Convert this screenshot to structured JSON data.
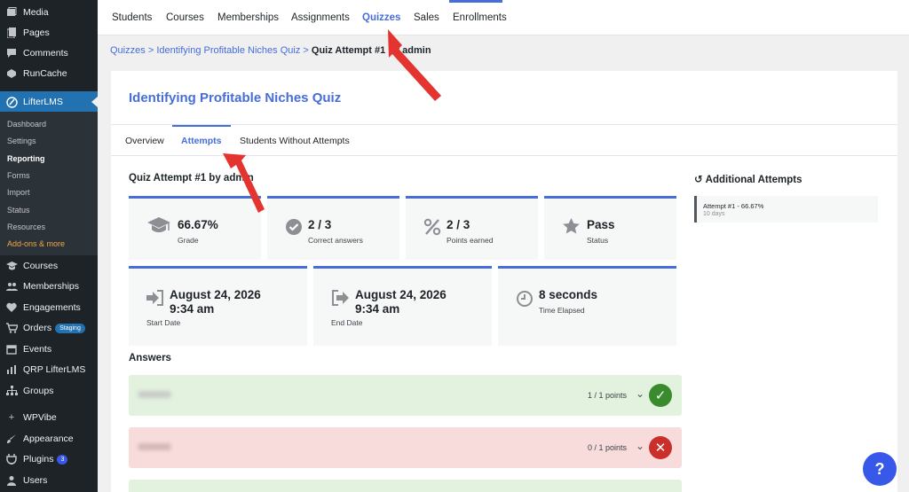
{
  "sidebar": {
    "items": [
      {
        "label": "Media",
        "icon": "media-icon"
      },
      {
        "label": "Pages",
        "icon": "pages-icon"
      },
      {
        "label": "Comments",
        "icon": "comments-icon"
      },
      {
        "label": "RunCache",
        "icon": "runcache-icon"
      },
      {
        "label": "LifterLMS",
        "icon": "lifterlms-icon"
      },
      {
        "label": "Courses",
        "icon": "courses-icon"
      },
      {
        "label": "Memberships",
        "icon": "memberships-icon"
      },
      {
        "label": "Engagements",
        "icon": "engagements-icon"
      },
      {
        "label": "Orders",
        "icon": "cart-icon",
        "badge": "Staging"
      },
      {
        "label": "Events",
        "icon": "events-icon"
      },
      {
        "label": "QRP LifterLMS",
        "icon": "chart-icon"
      },
      {
        "label": "Groups",
        "icon": "groups-icon"
      },
      {
        "label": "WPVibe",
        "icon": "plus-icon"
      },
      {
        "label": "Appearance",
        "icon": "appearance-icon"
      },
      {
        "label": "Plugins",
        "icon": "plugins-icon",
        "badge": "3"
      },
      {
        "label": "Users",
        "icon": "users-icon"
      }
    ],
    "submenu": [
      "Dashboard",
      "Settings",
      "Reporting",
      "Forms",
      "Import",
      "Status",
      "Resources",
      "Add-ons & more"
    ]
  },
  "topnav": [
    "Students",
    "Courses",
    "Memberships",
    "Assignments",
    "Quizzes",
    "Sales",
    "Enrollments"
  ],
  "breadcrumb": {
    "root": "Quizzes",
    "sep": ">",
    "quiz": "Identifying Profitable Niches Quiz",
    "current": "Quiz Attempt #1 by admin"
  },
  "quiz_title": "Identifying Profitable Niches Quiz",
  "subtabs": [
    "Overview",
    "Attempts",
    "Students Without Attempts"
  ],
  "attempt_heading": "Quiz Attempt #1 by admin",
  "stats": [
    {
      "value": "66.67%",
      "label": "Grade",
      "icon": "graduation-cap-icon"
    },
    {
      "value": "2 / 3",
      "label": "Correct answers",
      "icon": "check-circle-icon"
    },
    {
      "value": "2 / 3",
      "label": "Points earned",
      "icon": "percent-icon"
    },
    {
      "value": "Pass",
      "label": "Status",
      "icon": "star-icon"
    }
  ],
  "dates": [
    {
      "line1": "August 24, 2026",
      "line2": "9:34 am",
      "label": "Start Date",
      "icon": "sign-in-icon"
    },
    {
      "line1": "August 24, 2026",
      "line2": "9:34 am",
      "label": "End Date",
      "icon": "sign-out-icon"
    },
    {
      "line1": "8 seconds",
      "line2": "",
      "label": "Time Elapsed",
      "icon": "clock-icon"
    }
  ],
  "answers_heading": "Answers",
  "answers": [
    {
      "points": "1 / 1 points",
      "status": "correct"
    },
    {
      "points": "0 / 1 points",
      "status": "incorrect"
    }
  ],
  "additional": {
    "heading": "Additional Attempts",
    "icon": "history-icon",
    "item_title": "Attempt #1 - 66.67%",
    "item_date": "10 days"
  },
  "help_label": "?",
  "colors": {
    "accent": "#466dd8",
    "wp_blue": "#2271b1",
    "sidebar": "#1d2327",
    "arrow": "#e3342f"
  }
}
